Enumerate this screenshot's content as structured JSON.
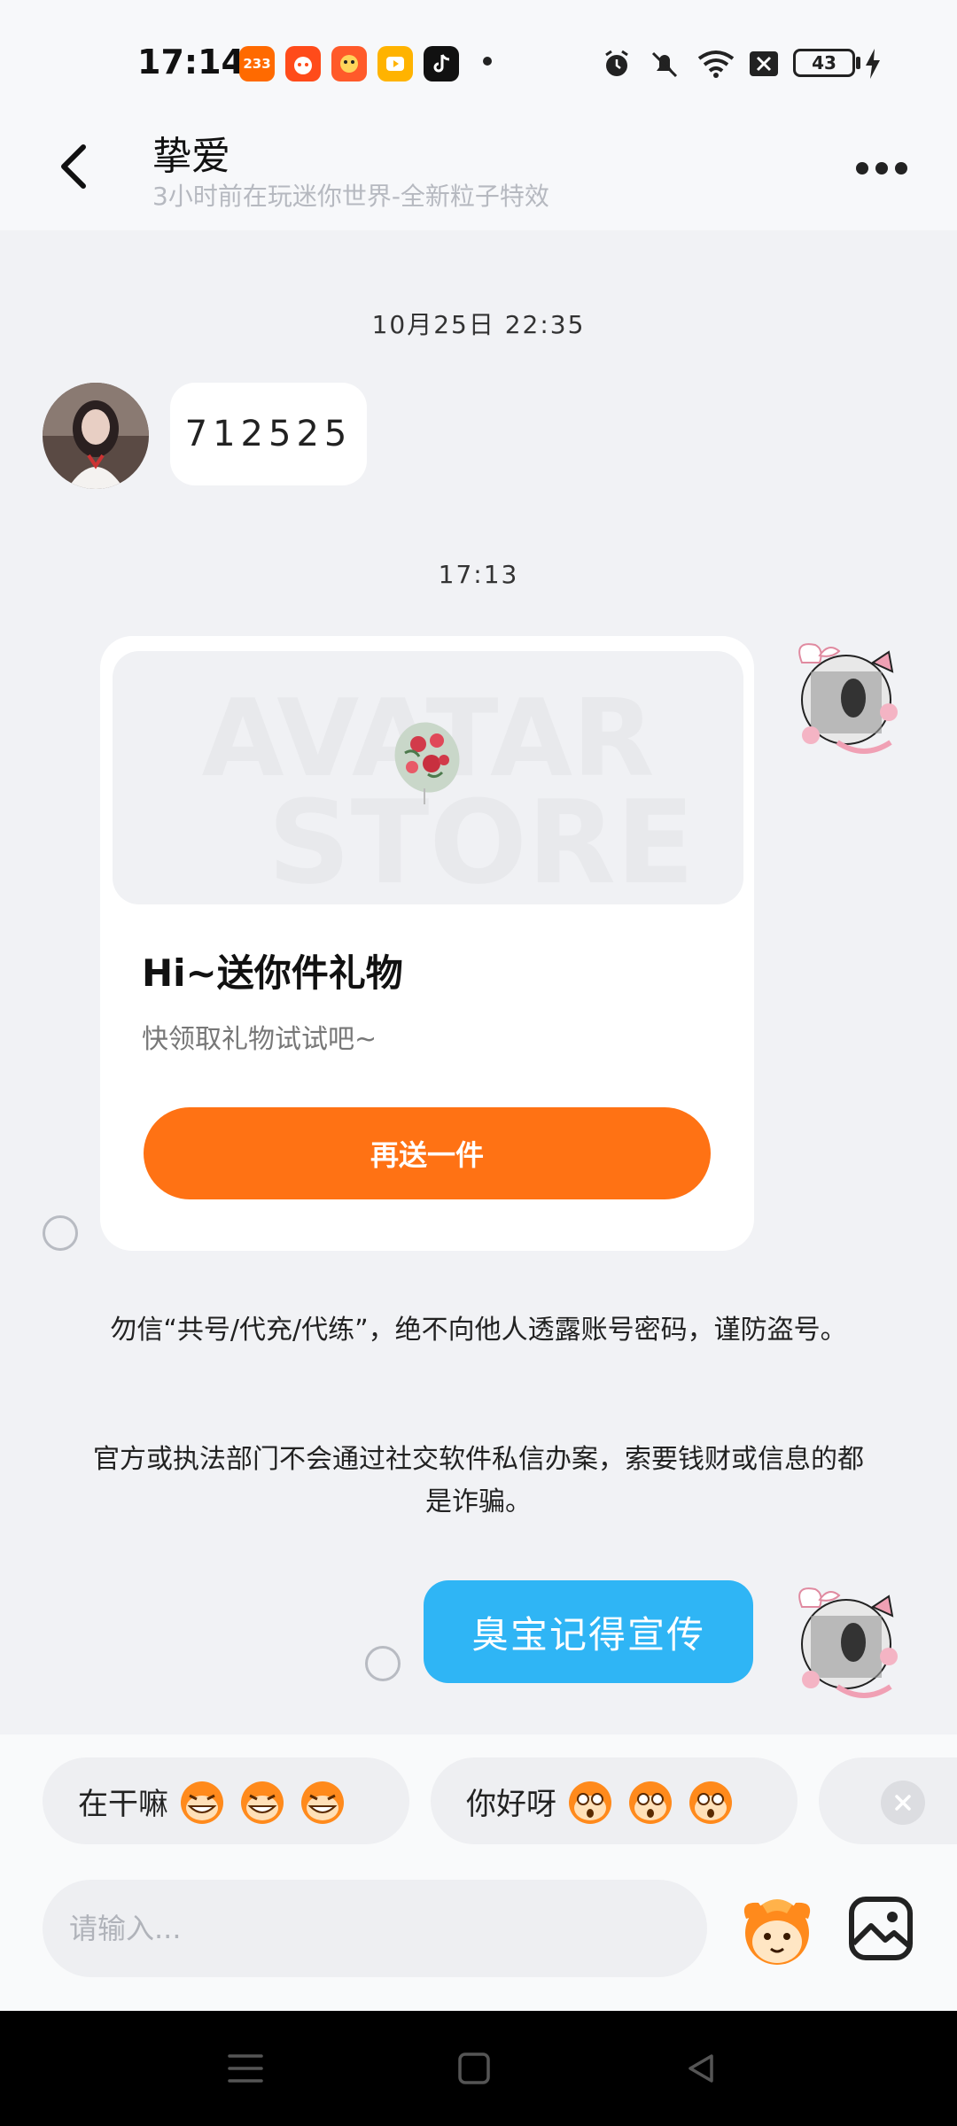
{
  "status_bar": {
    "time": "17:14",
    "apps": [
      {
        "icon": "233-app-icon",
        "label": "233",
        "color": "#ff6a00"
      },
      {
        "icon": "game-app-icon",
        "label": "",
        "color": "#ff4b1a"
      },
      {
        "icon": "cartoon-app-icon",
        "label": "",
        "color": "#ff5a2a"
      },
      {
        "icon": "video-app-icon",
        "label": "",
        "color": "#ffb300"
      },
      {
        "icon": "tiktok-icon",
        "label": "",
        "color": "#111111"
      }
    ],
    "battery": "43"
  },
  "header": {
    "title": "挚爱",
    "subtitle": "3小时前在玩迷你世界-全新粒子特效"
  },
  "chat": {
    "timestamp_1": "10月25日 22:35",
    "incoming_message": "712525",
    "timestamp_2": "17:13",
    "gift_card": {
      "watermark_line1": "AVATAR",
      "watermark_line2": "STORE",
      "title": "Hi~送你件礼物",
      "subtitle": "快领取礼物试试吧~",
      "button_label": "再送一件"
    },
    "notice_1": "勿信“共号/代充/代练”，绝不向他人透露账号密码，谨防盗号。",
    "notice_2": "官方或执法部门不会通过社交软件私信办案，索要钱财或信息的都是诈骗。",
    "outgoing_message": "臭宝记得宣传"
  },
  "quick_replies": [
    {
      "text": "在干嘛",
      "emoji": "grin-monkey-icon"
    },
    {
      "text": "你好呀",
      "emoji": "surprised-monkey-icon"
    }
  ],
  "input": {
    "placeholder": "请输入..."
  },
  "colors": {
    "accent_orange": "#ff7214",
    "bubble_blue": "#2fb5f5",
    "background": "#f1f2f5"
  }
}
